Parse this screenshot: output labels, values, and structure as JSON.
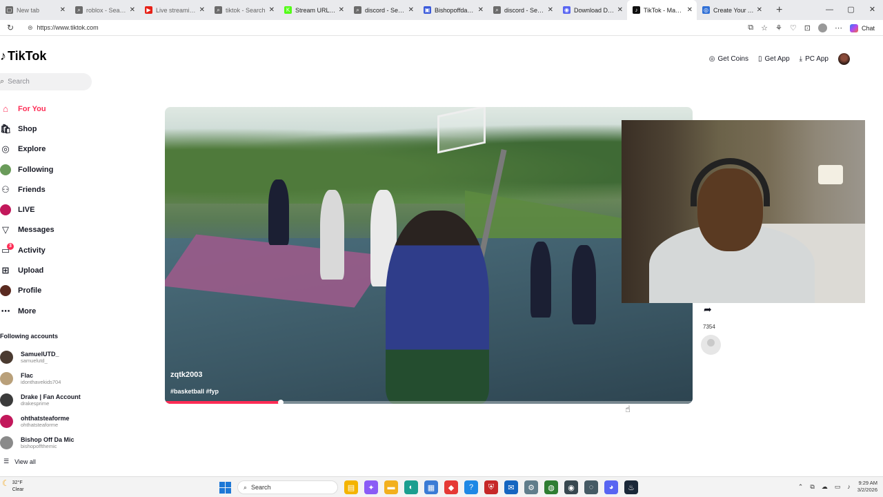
{
  "browser": {
    "tabs": [
      {
        "label": "New tab",
        "color": "#6b6b6b",
        "glyph": "▢",
        "active": false
      },
      {
        "label": "roblox - Search",
        "color": "#6b6b6b",
        "glyph": "⌕",
        "active": false
      },
      {
        "label": "Live streaming - Y",
        "color": "#e62117",
        "glyph": "▶",
        "active": false
      },
      {
        "label": "tiktok - Search",
        "color": "#6b6b6b",
        "glyph": "⌕",
        "active": false
      },
      {
        "label": "Stream URL & Ke",
        "color": "#53fc18",
        "glyph": "K",
        "active": false
      },
      {
        "label": "discord - Search",
        "color": "#6b6b6b",
        "glyph": "⌕",
        "active": false
      },
      {
        "label": "Bishopoffdamic1",
        "color": "#3b5bdb",
        "glyph": "▣",
        "active": false
      },
      {
        "label": "discord - Search",
        "color": "#6b6b6b",
        "glyph": "⌕",
        "active": false
      },
      {
        "label": "Download Discor",
        "color": "#5865f2",
        "glyph": "◉",
        "active": false
      },
      {
        "label": "TikTok - Make Yo",
        "color": "#111111",
        "glyph": "♪",
        "active": true
      },
      {
        "label": "Create Your Accou",
        "color": "#2f6fd6",
        "glyph": "◎",
        "active": false
      }
    ],
    "new_tab": "+",
    "window_controls": [
      "—",
      "▢",
      "✕"
    ],
    "url": "https://www.tiktok.com",
    "copilot_label": "Chat"
  },
  "tiktok": {
    "logo_text": "TikTok",
    "search_placeholder": "Search",
    "header": {
      "get_coins": "Get Coins",
      "get_app": "Get App",
      "pc_app": "PC App"
    },
    "nav": [
      {
        "label": "For You",
        "icon": "home-icon",
        "glyph": "⌂",
        "active": true
      },
      {
        "label": "Shop",
        "icon": "shop-icon",
        "glyph": "🛍",
        "active": false
      },
      {
        "label": "Explore",
        "icon": "compass-icon",
        "glyph": "◎",
        "active": false
      },
      {
        "label": "Following",
        "icon": "following-avatar-icon",
        "glyph": "",
        "avatar": "#6a9b5a",
        "active": false
      },
      {
        "label": "Friends",
        "icon": "friends-icon",
        "glyph": "⚇",
        "active": false
      },
      {
        "label": "LIVE",
        "icon": "live-avatar-icon",
        "glyph": "",
        "avatar": "#c2185b",
        "active": false
      },
      {
        "label": "Messages",
        "icon": "messages-icon",
        "glyph": "▽",
        "active": false
      },
      {
        "label": "Activity",
        "icon": "activity-icon",
        "glyph": "▭",
        "badge": "3",
        "active": false
      },
      {
        "label": "Upload",
        "icon": "upload-icon",
        "glyph": "⊞",
        "active": false
      },
      {
        "label": "Profile",
        "icon": "profile-avatar-icon",
        "glyph": "",
        "avatar": "#5a2a20",
        "active": false
      },
      {
        "label": "More",
        "icon": "more-icon",
        "glyph": "⋯",
        "active": false
      }
    ],
    "following_title": "Following accounts",
    "following": [
      {
        "name": "SamuelUTD_",
        "handle": "samuelutd_",
        "color": "#4a3a30"
      },
      {
        "name": "Flac",
        "handle": "idonthavekids704",
        "color": "#b9a07a"
      },
      {
        "name": "Drake | Fan Account",
        "handle": "drakesprime",
        "color": "#3b3b3b"
      },
      {
        "name": "ohthatsteaforme",
        "handle": "ohthatsteaforme",
        "color": "#c2185b"
      },
      {
        "name": "Bishop Off Da Mic",
        "handle": "bishopoffthemic",
        "color": "#8a8a8a"
      }
    ],
    "view_all": "View all",
    "video": {
      "username": "zqtk2003",
      "tags": "#basketball #fyp",
      "progress": 0.22
    },
    "share_count": "7354"
  },
  "taskbar": {
    "temp": "32°F",
    "condition": "Clear",
    "search": "Search",
    "time": "9:29 AM",
    "date": "3/2/2026",
    "apps": [
      {
        "name": "file-explorer-icon",
        "color": "#f4b400",
        "glyph": "▤"
      },
      {
        "name": "copilot-app-icon",
        "color": "#8a5cf6",
        "glyph": "✦"
      },
      {
        "name": "folder-icon",
        "color": "#f2b01e",
        "glyph": "▬"
      },
      {
        "name": "edge-icon",
        "color": "#1a9e8f",
        "glyph": "◐"
      },
      {
        "name": "store-icon",
        "color": "#3a7bd5",
        "glyph": "▦"
      },
      {
        "name": "app-red-icon",
        "color": "#e53935",
        "glyph": "◆"
      },
      {
        "name": "help-icon",
        "color": "#1e88e5",
        "glyph": "?"
      },
      {
        "name": "shield-icon",
        "color": "#c62828",
        "glyph": "⛨"
      },
      {
        "name": "outlook-icon",
        "color": "#1565c0",
        "glyph": "✉"
      },
      {
        "name": "settings-icon",
        "color": "#607d8b",
        "glyph": "⚙"
      },
      {
        "name": "xbox-icon",
        "color": "#2e7d32",
        "glyph": "◍"
      },
      {
        "name": "obs-icon",
        "color": "#37474f",
        "glyph": "◉"
      },
      {
        "name": "browser-icon",
        "color": "#455a64",
        "glyph": "◌"
      },
      {
        "name": "discord-icon",
        "color": "#5865f2",
        "glyph": "◕"
      },
      {
        "name": "steam-icon",
        "color": "#1b2838",
        "glyph": "♨"
      }
    ]
  }
}
